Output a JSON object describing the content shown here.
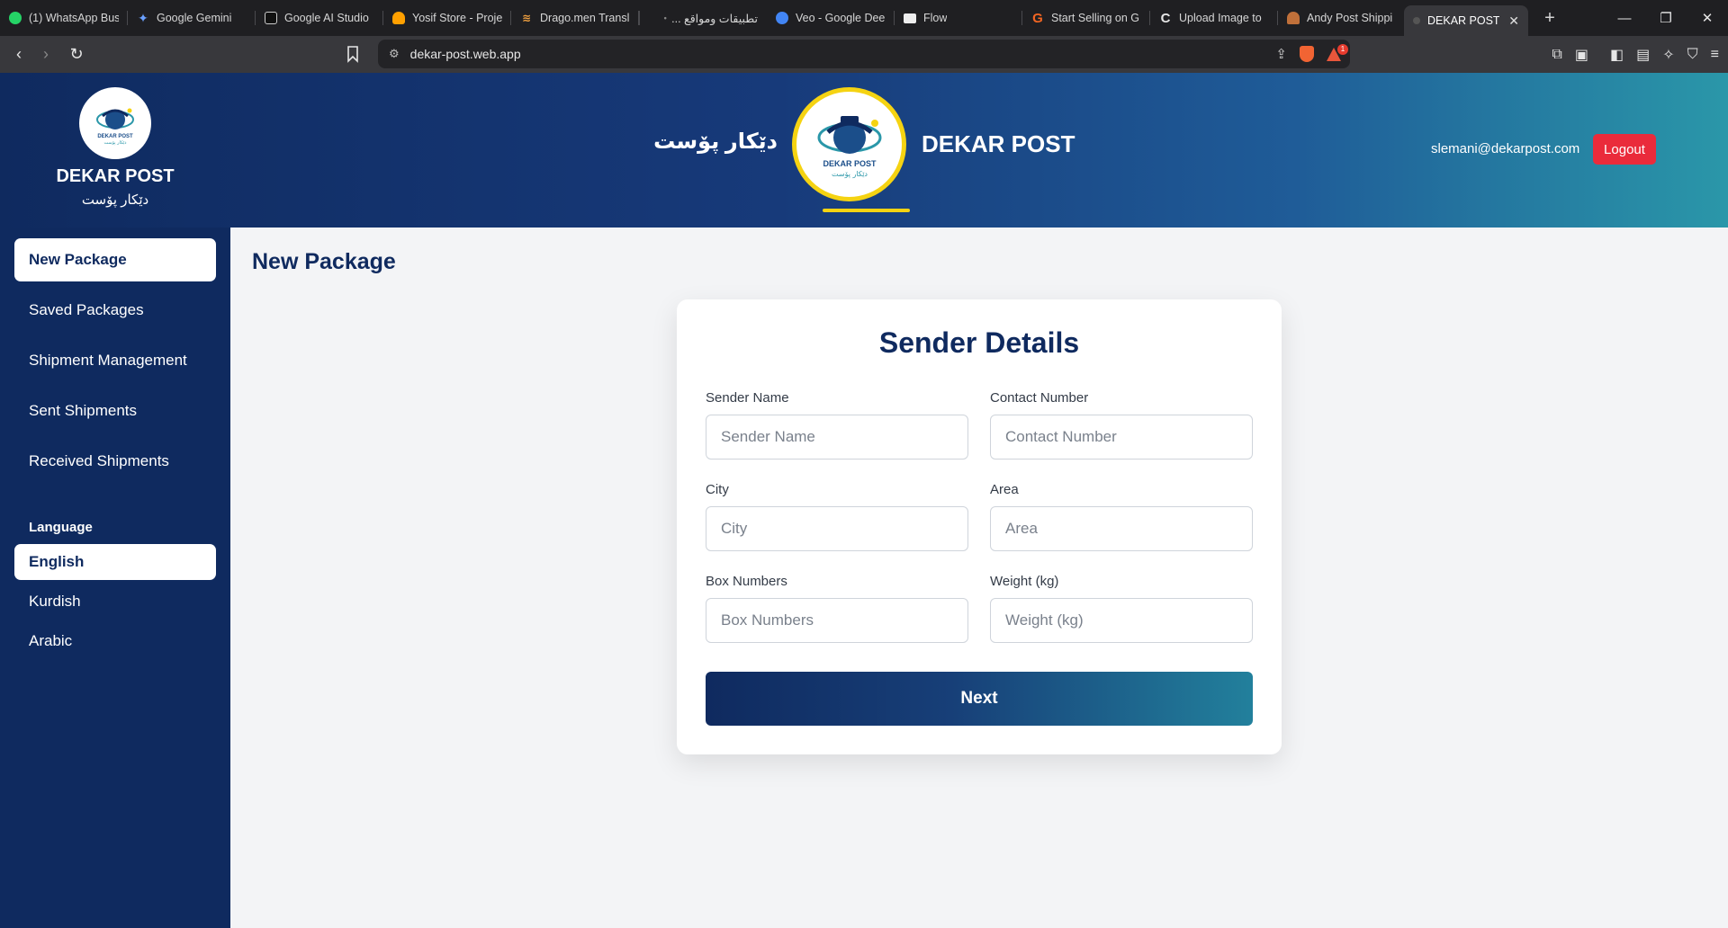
{
  "browser": {
    "tabs": [
      {
        "label": "(1) WhatsApp Bus",
        "icon": "whatsapp-icon",
        "color": "#25d366"
      },
      {
        "label": "Google Gemini",
        "icon": "gemini-icon",
        "color": "#5b8def"
      },
      {
        "label": "Google AI Studio",
        "icon": "ai-studio-icon",
        "color": "#dddddd"
      },
      {
        "label": "Yosif Store - Proje",
        "icon": "firebase-icon",
        "color": "#ffa000"
      },
      {
        "label": "Drago.men Transl",
        "icon": "dragomen-icon",
        "color": "#f0a040"
      },
      {
        "label": "تطبيقات ومواقع ...",
        "icon": "site-icon",
        "color": "#888888"
      },
      {
        "label": "Veo - Google Dee",
        "icon": "veo-icon",
        "color": "#4285f4"
      },
      {
        "label": "Flow",
        "icon": "flow-icon",
        "color": "#dddddd"
      },
      {
        "label": "Start Selling on G",
        "icon": "g-icon",
        "color": "#f26522"
      },
      {
        "label": "Upload Image to",
        "icon": "c-icon",
        "color": "#dddddd"
      },
      {
        "label": "Andy Post Shippi",
        "icon": "andy-icon",
        "color": "#c0703a"
      },
      {
        "label": "DEKAR POST",
        "icon": "dekar-icon",
        "color": "#555555"
      }
    ],
    "url": "dekar-post.web.app",
    "shields_badge": "1"
  },
  "header": {
    "brand_title": "DEKAR POST",
    "brand_subtitle": "دێکار پۆست",
    "center_kurdish": "دێکار پۆست",
    "center_english": "DEKAR POST",
    "logo_text_en": "DEKAR POST",
    "logo_text_ku": "دێکار پۆست",
    "user_email": "slemani@dekarpost.com",
    "logout_label": "Logout"
  },
  "sidebar": {
    "items": [
      {
        "label": "New Package",
        "active": true
      },
      {
        "label": "Saved Packages",
        "active": false
      },
      {
        "label": "Shipment Management",
        "active": false
      },
      {
        "label": "Sent Shipments",
        "active": false
      },
      {
        "label": "Received Shipments",
        "active": false
      }
    ],
    "language_heading": "Language",
    "languages": [
      {
        "label": "English",
        "active": true
      },
      {
        "label": "Kurdish",
        "active": false
      },
      {
        "label": "Arabic",
        "active": false
      }
    ]
  },
  "main": {
    "page_title": "New Package",
    "form": {
      "title": "Sender Details",
      "fields": {
        "sender_name": {
          "label": "Sender Name",
          "placeholder": "Sender Name",
          "value": ""
        },
        "contact_number": {
          "label": "Contact Number",
          "placeholder": "Contact Number",
          "value": ""
        },
        "city": {
          "label": "City",
          "placeholder": "City",
          "value": ""
        },
        "area": {
          "label": "Area",
          "placeholder": "Area",
          "value": ""
        },
        "box_numbers": {
          "label": "Box Numbers",
          "placeholder": "Box Numbers",
          "value": ""
        },
        "weight": {
          "label": "Weight (kg)",
          "placeholder": "Weight (kg)",
          "value": ""
        }
      },
      "next_label": "Next"
    }
  },
  "colors": {
    "primary": "#0f2a5f",
    "accent_yellow": "#f5d312",
    "danger": "#ea2b3b",
    "gradient_end": "#2a97a9"
  }
}
